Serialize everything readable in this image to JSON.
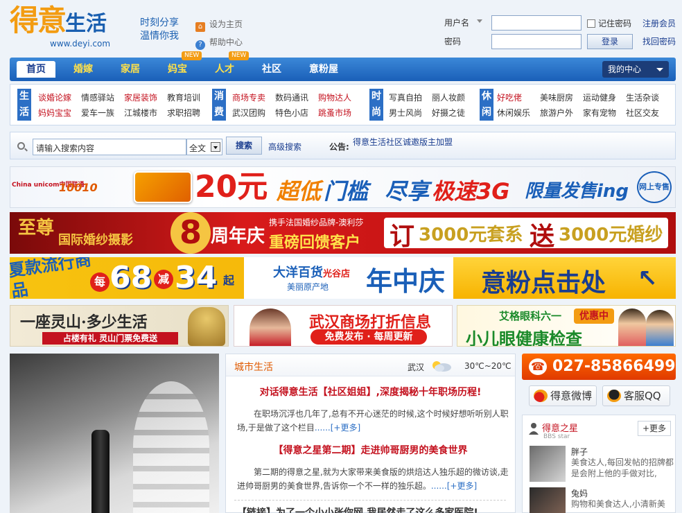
{
  "header": {
    "logo_main": "得意",
    "logo_sub": "生活",
    "logo_url": "www.deyi.com",
    "slogan_1": "时刻分享",
    "slogan_2": "温情你我",
    "set_home": "设为主页",
    "help": "帮助中心"
  },
  "login": {
    "username_label": "用户名",
    "password_label": "密码",
    "remember": "记住密码",
    "login_btn": "登录",
    "register": "注册会员",
    "forgot": "找回密码"
  },
  "nav": {
    "items": [
      {
        "label": "首页"
      },
      {
        "label": "婚嫁"
      },
      {
        "label": "家居"
      },
      {
        "label": "妈宝"
      },
      {
        "label": "人才"
      },
      {
        "label": "社区"
      },
      {
        "label": "意粉屋"
      }
    ],
    "new_badge": "NEW",
    "my_center": "我的中心"
  },
  "categories": {
    "groups": [
      {
        "tag": [
          "生",
          "活"
        ],
        "links": [
          [
            "谈婚论嫁",
            "情感驿站",
            "家居装饰",
            "教育培训"
          ],
          [
            "妈妈宝宝",
            "爱车一族",
            "江城楼市",
            "求职招聘"
          ]
        ]
      },
      {
        "tag": [
          "消",
          "费"
        ],
        "links": [
          [
            "商场专卖",
            "数码通讯",
            "购物达人"
          ],
          [
            "武汉团购",
            "特色小店",
            "跳蚤市场"
          ]
        ]
      },
      {
        "tag": [
          "时",
          "尚"
        ],
        "links": [
          [
            "写真自拍",
            "丽人妆颜"
          ],
          [
            "男士风尚",
            "好摄之徒"
          ]
        ]
      },
      {
        "tag": [
          "休",
          "闲"
        ],
        "links": [
          [
            "好吃佬",
            "美味厨房",
            "运动健身",
            "生活杂谈"
          ],
          [
            "休闲娱乐",
            "旅游户外",
            "家有宠物",
            "社区交友"
          ]
        ]
      }
    ]
  },
  "search": {
    "placeholder": "请输入搜索内容",
    "scope": "全文",
    "button": "搜索",
    "advanced": "高级搜索",
    "notice_label": "公告:",
    "notice_text": "得意生活社区诚邀版主加盟"
  },
  "banners": {
    "b1": {
      "brand": "China unicom中国联通",
      "num": "10010",
      "price": "20元",
      "text1": "超低",
      "text2": "门槛",
      "text3": "尽享",
      "text4": "极速3G",
      "text5": "限量发售ing",
      "badge": "网上专售"
    },
    "b2": {
      "brand": "至尊",
      "brand_sub": "国际婚纱摄影",
      "num": "8",
      "text1": "周年庆",
      "text2": "携手法国婚纱品牌-澳利莎",
      "text3": "重磅回馈客户",
      "text4": "订",
      "text5": "3000元套系",
      "text6": "送",
      "text7": "3000元婚纱"
    },
    "b3": {
      "text1": "夏款流行商品",
      "text2": "每",
      "text3": "68",
      "text4": "减",
      "text5": "34",
      "text6": "起",
      "brand": "大洋百货",
      "brand2": "光谷店",
      "brand3": "美丽原产地",
      "text7": "年中庆",
      "text8": "意粉点击处"
    },
    "b4a": {
      "title": "一座灵山·多少生活",
      "sub": "占楼有礼 灵山门票免费送"
    },
    "b4b": {
      "title": "武汉商场打折信息",
      "sub": "免费发布 · 每周更新"
    },
    "b4c": {
      "title": "艾格眼科六一",
      "tag": "优惠中",
      "sub": "小儿眼健康检查"
    }
  },
  "city": {
    "title": "城市生活",
    "city": "武汉",
    "temp": "30℃~20℃",
    "h1": "对话得意生活【社区姐姐】,深度揭秘十年职场历程!",
    "p1": "在职场沉浮也几年了,总有不开心迷茫的时候,这个时候好想听听别人职场,于是做了这个栏目",
    "more1": "......[+更多]",
    "h2": "【得意之星第二期】走进帅哥厨男的美食世界",
    "p2": "第二期的得意之星,就为大家带来美食版的烘焙达人独乐超的微访谈,走进帅哥厨男的美食世界,告诉你一个不一样的独乐超。",
    "more2": "......[+更多]",
    "h3": "【链接】为了一个小小张你网,我居然走了这么多家医院!"
  },
  "right": {
    "phone": "027-85866499",
    "weibo": "得意微博",
    "qq": "客服QQ",
    "star_title": "得意之星",
    "star_sub": "BBS star",
    "star_more": "+更多",
    "p1_name": "胖子",
    "p1_desc": "美食达人,每回发帖的招牌都是会附上他的手做对比,",
    "p2_name": "兔妈",
    "p2_desc": "购物和美食达人,小清新美"
  },
  "colors": {
    "brand_blue": "#1a5fb8",
    "accent_orange": "#f39c12",
    "link_red": "#c4121f"
  }
}
